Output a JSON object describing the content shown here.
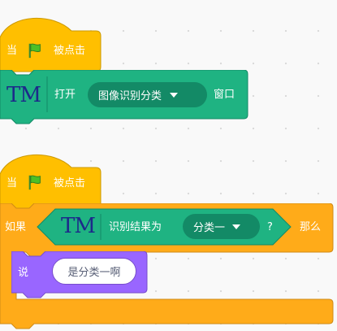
{
  "script1": {
    "hat": {
      "prefix": "当",
      "suffix": "被点击",
      "flag_icon": "green-flag-icon"
    },
    "open_block": {
      "ext_icon": "TM",
      "label_before": "打开",
      "dropdown_value": "图像识别分类",
      "label_after": "窗口"
    }
  },
  "script2": {
    "hat": {
      "prefix": "当",
      "suffix": "被点击",
      "flag_icon": "green-flag-icon"
    },
    "if_block": {
      "label_if": "如果",
      "condition": {
        "ext_icon": "TM",
        "label": "识别结果为",
        "dropdown_value": "分类一",
        "question": "?"
      },
      "label_then": "那么"
    },
    "say_block": {
      "label": "说",
      "value": "是分类一啊"
    }
  },
  "colors": {
    "events_yellow": "#ffbf00",
    "events_dark": "#cc9900",
    "extension_green": "#1fb382",
    "extension_dark": "#138a66",
    "control_orange": "#ffab19",
    "control_dark": "#cf8b17",
    "looks_purple": "#9966ff",
    "looks_dark": "#774dcb"
  }
}
